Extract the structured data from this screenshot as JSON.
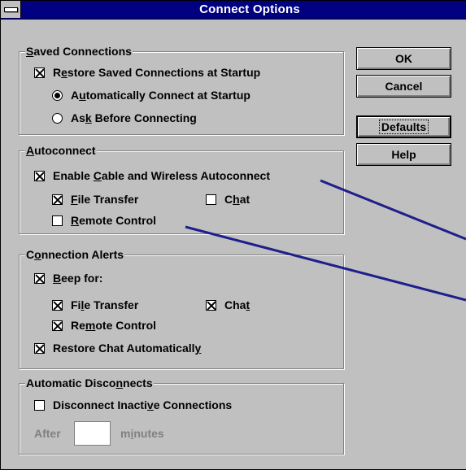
{
  "window": {
    "title": "Connect Options"
  },
  "groups": {
    "saved": {
      "label": "Saved Connections",
      "restore": {
        "label": "Restore Saved Connections at Startup",
        "checked": true
      },
      "auto_connect": {
        "label": "Automatically Connect at Startup",
        "selected": true
      },
      "ask_before": {
        "label": "Ask Before Connecting",
        "selected": false
      }
    },
    "autoconnect": {
      "label": "Autoconnect",
      "enable": {
        "label": "Enable Cable and Wireless Autoconnect",
        "checked": true
      },
      "file_transfer": {
        "label": "File Transfer",
        "checked": true
      },
      "chat": {
        "label": "Chat",
        "checked": false
      },
      "remote_control": {
        "label": "Remote Control",
        "checked": false
      }
    },
    "alerts": {
      "label": "Connection Alerts",
      "beep_for": {
        "label": "Beep for:",
        "checked": true
      },
      "file_transfer": {
        "label": "File Transfer",
        "checked": true
      },
      "chat": {
        "label": "Chat",
        "checked": true
      },
      "remote_control": {
        "label": "Remote Control",
        "checked": true
      },
      "restore_chat": {
        "label": "Restore Chat Automatically",
        "checked": true
      }
    },
    "disconnect": {
      "label": "Automatic Disconnects",
      "disconnect_inactive": {
        "label": "Disconnect Inactive Connections",
        "checked": false
      },
      "after_label": "After",
      "minutes_value": "",
      "minutes_label": "minutes"
    }
  },
  "buttons": {
    "ok": "OK",
    "cancel": "Cancel",
    "defaults": "Defaults",
    "help": "Help"
  },
  "colors": {
    "title_bar": "#000080",
    "face": "#c0c0c0",
    "callout_line": "#1e1e8c"
  }
}
